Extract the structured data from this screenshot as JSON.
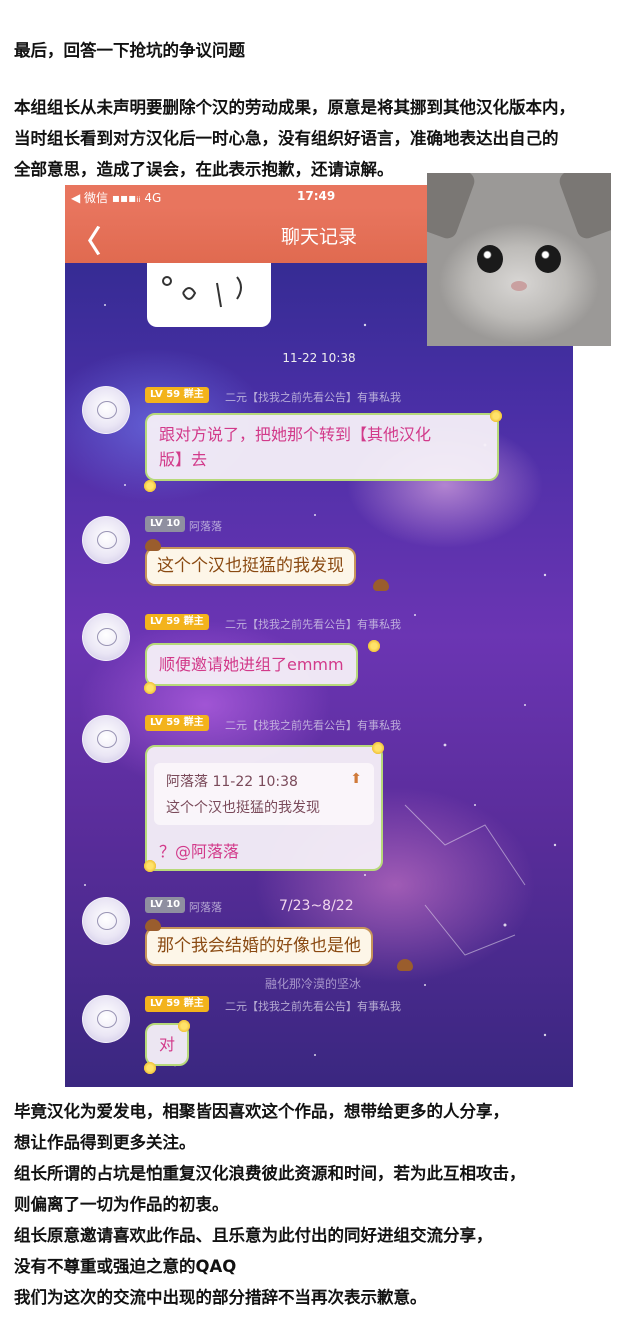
{
  "intro": {
    "title": "最后，回答一下抢坑的争议问题",
    "lines": [
      "本组组长从未声明要删除个汉的劳动成果，原意是将其挪到其他汉化版本内，",
      "当时组长看到对方汉化后一时心急，没有组织好语言，准确地表达出自己的",
      "全部意思，造成了误会，在此表示抱歉，还请谅解。"
    ]
  },
  "phone": {
    "status": {
      "left": "◀ 微信 ▪▪▪ᵢᵢ 4G",
      "time": "17:49"
    },
    "nav": {
      "back": "〈",
      "title": "聊天记录"
    },
    "timestamp": "11-22 10:38",
    "messages": [
      {
        "level": "LV 59",
        "role": "群主",
        "nick": "二元【找我之前先看公告】有事私我",
        "text_line1": "跟对方说了，把她那个转到【其他汉化",
        "text_line2": "版】去"
      },
      {
        "level": "LV 10",
        "nick": "阿落落",
        "text": "这个个汉也挺猛的我发现"
      },
      {
        "level": "LV 59",
        "role": "群主",
        "nick": "二元【找我之前先看公告】有事私我",
        "text": "顺便邀请她进组了emmm"
      },
      {
        "level": "LV 59",
        "role": "群主",
        "nick": "二元【找我之前先看公告】有事私我",
        "quote_header": "阿落落 11-22 10:38",
        "quote_body": "这个个汉也挺猛的我发现",
        "text": "？@阿落落"
      },
      {
        "level": "LV 10",
        "nick": "阿落落",
        "text": "那个我会结婚的好像也是他"
      },
      {
        "level": "LV 59",
        "role": "群主",
        "nick": "二元【找我之前先看公告】有事私我",
        "text": "对"
      }
    ],
    "watermark_date": "7/23~8/22",
    "watermark_text": "融化那冷漠的坚冰"
  },
  "outro": {
    "lines": [
      "毕竟汉化为爱发电，相聚皆因喜欢这个作品，想带给更多的人分享，",
      "想让作品得到更多关注。",
      "组长所谓的占坑是怕重复汉化浪费彼此资源和时间，若为此互相攻击，",
      "则偏离了一切为作品的初衷。",
      "组长原意邀请喜欢此作品、且乐意为此付出的同好进组交流分享，",
      "没有不尊重或强迫之意的QAQ",
      "我们为这次的交流中出现的部分措辞不当再次表示歉意。"
    ]
  },
  "icons": {
    "back": "chevron-left-icon",
    "quote_arrow": "arrow-up-icon"
  },
  "colors": {
    "header": "#e8755e",
    "level59": "#f3b31c",
    "level10": "#8f8fa0",
    "bubble_green_border": "#b7d97a",
    "bubble_brown_border": "#c7955a"
  }
}
